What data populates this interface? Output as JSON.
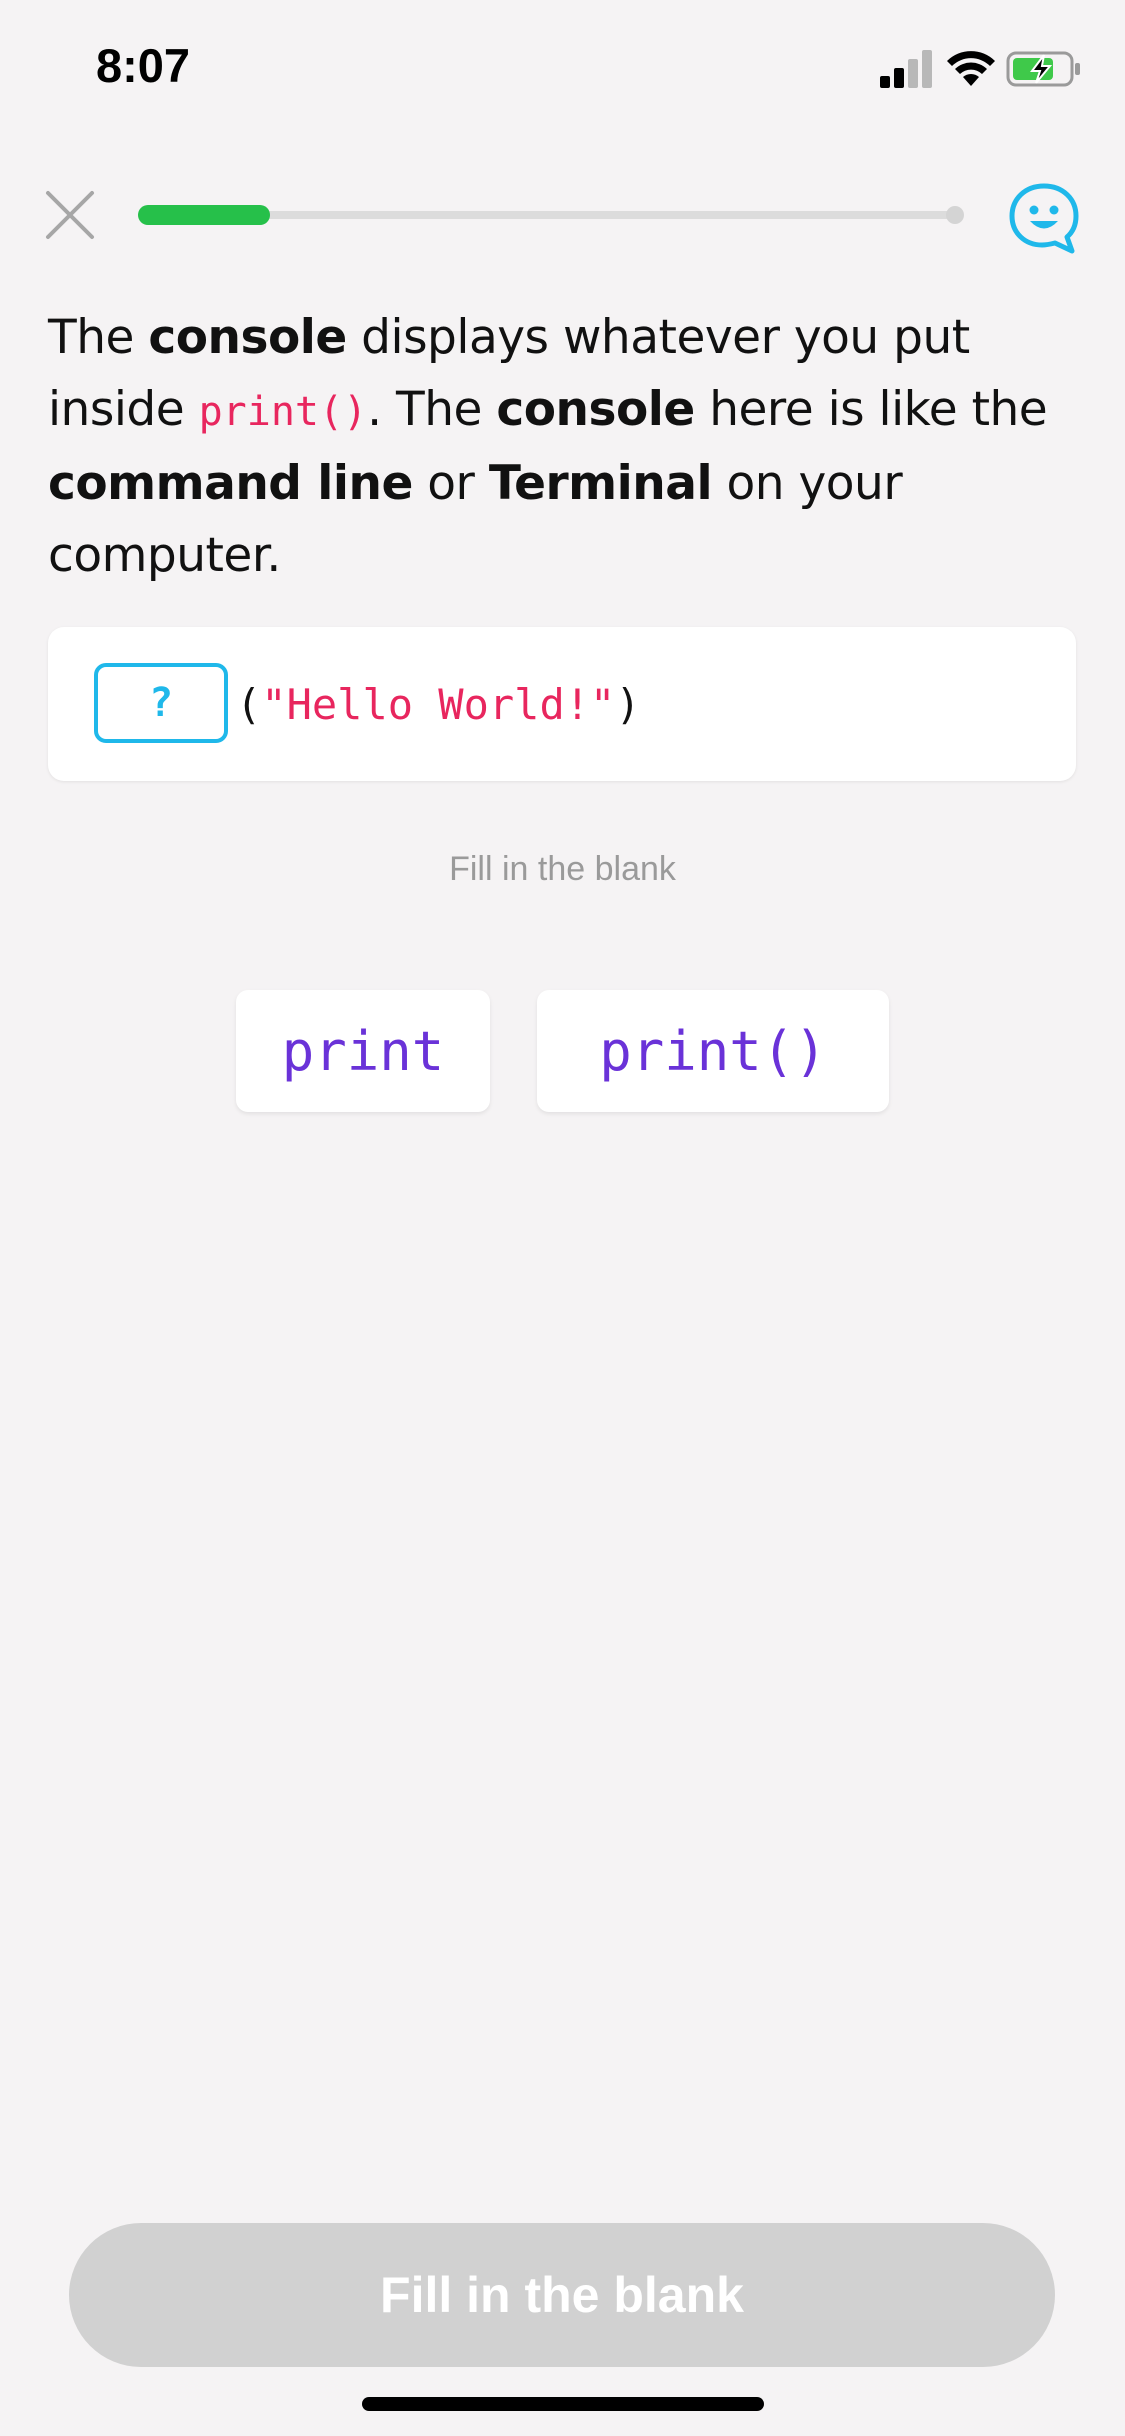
{
  "status_bar": {
    "time": "8:07",
    "battery_color": "#3fc94a"
  },
  "header": {
    "progress_fraction": 0.16,
    "progress_color": "#26c04a",
    "help_icon_color": "#1fb8ea"
  },
  "lesson": {
    "segments": [
      {
        "style": "text",
        "value": "The "
      },
      {
        "style": "bold",
        "value": "console"
      },
      {
        "style": "text",
        "value": " displays whatever you put inside "
      },
      {
        "style": "code",
        "value": "print()"
      },
      {
        "style": "text",
        "value": ". The "
      },
      {
        "style": "bold",
        "value": "console"
      },
      {
        "style": "text",
        "value": " here is like the "
      },
      {
        "style": "bold",
        "value": "command line"
      },
      {
        "style": "text",
        "value": " or "
      },
      {
        "style": "bold",
        "value": "Terminal"
      },
      {
        "style": "text",
        "value": " on your computer."
      }
    ]
  },
  "code_block": {
    "blank_placeholder": "?",
    "open_paren": "(",
    "string_literal": "\"Hello World!\"",
    "close_paren": ")"
  },
  "hint": "Fill in the blank",
  "options": [
    {
      "label": "print"
    },
    {
      "label": "print()"
    }
  ],
  "submit_button": {
    "label": "Fill in the blank",
    "enabled": false
  },
  "colors": {
    "code_string": "#e8265e",
    "option_text": "#6a32d8",
    "blank_border": "#1fb8ea"
  }
}
